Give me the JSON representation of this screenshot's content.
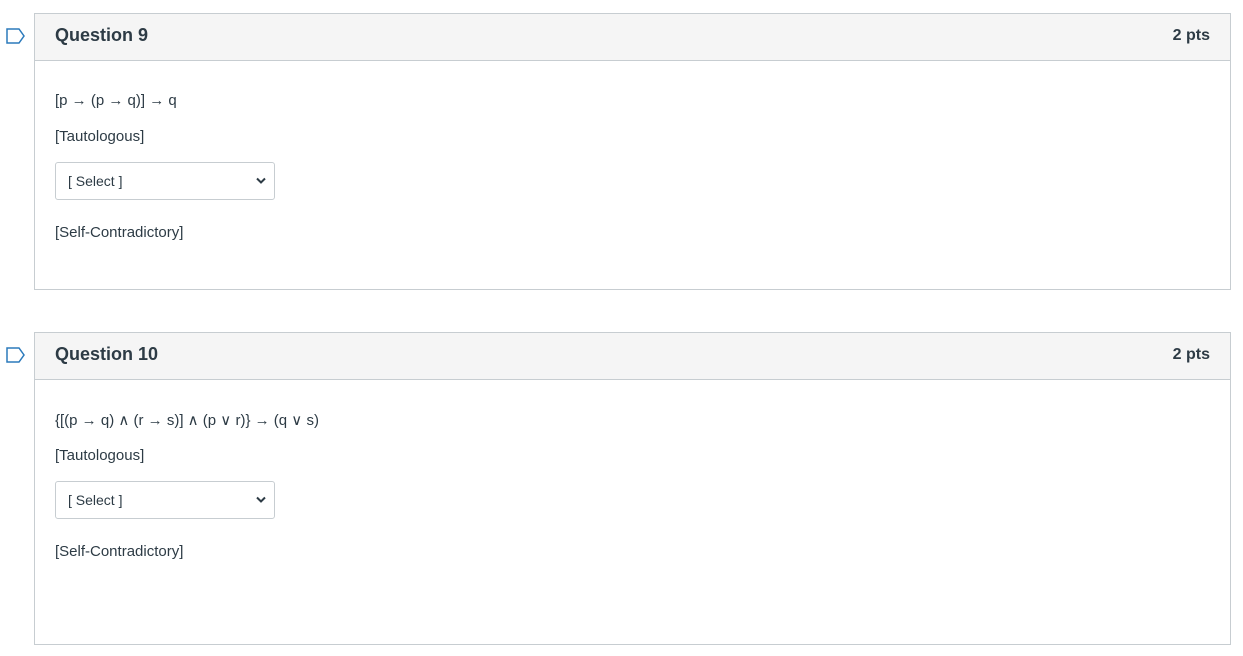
{
  "questions": [
    {
      "title": "Question 9",
      "points": "2 pts",
      "statement": "[p → (p → q)] → q",
      "label_before": "[Tautologous]",
      "select_value": "[ Select ]",
      "label_after": "[Self-Contradictory]"
    },
    {
      "title": "Question 10",
      "points": "2 pts",
      "statement": "{[(p → q) ∧ (r → s)] ∧  (p ∨ r)} → (q ∨ s)",
      "label_before": "[Tautologous]",
      "select_value": "[ Select ]",
      "label_after": "[Self-Contradictory]"
    }
  ],
  "colors": {
    "border": "#c7cdd1",
    "header_bg": "#f5f5f5",
    "text": "#2d3b45",
    "flag_stroke": "#2b7abc"
  },
  "icons": {
    "flag": "bookmark-flag-icon",
    "dropdown": "chevron-down-icon"
  }
}
